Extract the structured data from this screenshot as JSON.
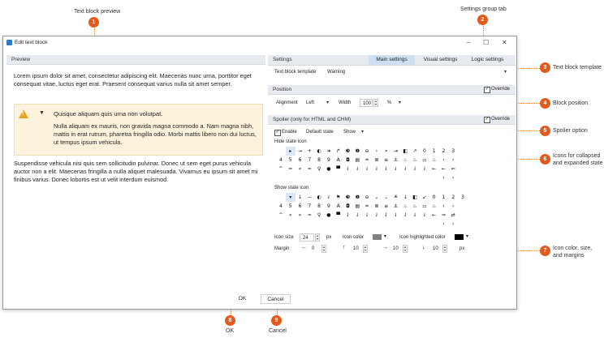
{
  "callouts": [
    {
      "n": "1",
      "label": "Text block preview"
    },
    {
      "n": "2",
      "label": "Settings group tab"
    },
    {
      "n": "3",
      "label": "Text block template"
    },
    {
      "n": "4",
      "label": "Block position"
    },
    {
      "n": "5",
      "label": "Spoiler option"
    },
    {
      "n": "6",
      "label": "Icons for collapsed\nand expanded state"
    },
    {
      "n": "7",
      "label": "Icon color, size,\nand margins"
    },
    {
      "n": "8",
      "label": "OK"
    },
    {
      "n": "9",
      "label": "Cancel"
    }
  ],
  "window": {
    "title": "Edit text block",
    "minimize": "–",
    "maximize": "☐",
    "close": "✕"
  },
  "preview": {
    "header": "Preview",
    "para1": "Lorem ipsum dolor sit amet, consectetur adipiscing elit. Maecenas nunc urna, porttitor eget consequat vitae, luctus eget erat. Praesent consequat varius nulla sit amet semper.",
    "warn_title": "Quisque aliquam quis urna non volutpat.",
    "warn_body": "Nulla aliquam ex mauris, non gravida magna commodo a. Nam magna nibh, mattis in erat rutrum, pharetra fringilla odio. Morbi mattis libero non dui luctus, ut tempus ipsum vehicula.",
    "para2": "Suspendisse vehicula nisi quis sem sollicitudin pulvinar. Donec ut sem eget purus vehicula auctor non a elit. Maecenas fringilla a nulla aliquet malesuada. Vivamus eu ipsum sit amet mi finibus varius. Donec lobortis est ut velit interdum euismod."
  },
  "settings": {
    "header": "Settings",
    "tabs": [
      "Main settings",
      "Visual settings",
      "Logic settings"
    ],
    "template_label": "Text block template",
    "template_value": "Warning",
    "position_header": "Position",
    "override_label": "Override",
    "alignment_label": "Alignment",
    "alignment_value": "Left",
    "width_label": "Width",
    "width_value": "100",
    "width_unit": "%",
    "spoiler_header": "Spoiler (only for HTML and CHM)",
    "enable_label": "Enable",
    "default_state_label": "Default state",
    "default_state_value": "Show",
    "hide_icon_label": "Hide state icon",
    "show_icon_label": "Show state icon",
    "icon_size_label": "Icon size",
    "icon_size_value": "24",
    "icon_size_unit": "px",
    "icon_color_label": "Icon color",
    "icon_color": "#808080",
    "icon_hl_label": "Icon highlighted color",
    "icon_hl_color": "#000000",
    "margin_label": "Margin",
    "margin_left": "0",
    "margin_top": "10",
    "margin_right": "10",
    "margin_bottom": "10",
    "margin_unit": "px"
  },
  "hide_icons": [
    [
      "·",
      "▸",
      "→",
      "+",
      "◐",
      "➜",
      "↱",
      "❸",
      "❶",
      "⊖",
      "›",
      "»",
      "⇥",
      "◧",
      "↗",
      "0",
      "1",
      "2",
      "3"
    ],
    [
      "4",
      "5",
      "6",
      "7",
      "8",
      "9",
      "A",
      "◘",
      "▤",
      "≐",
      "≣",
      "≡",
      "⚓",
      "♨",
      "♨",
      "⚏",
      "♨",
      "‹",
      "›"
    ],
    [
      "^",
      "≈",
      "«",
      "≈",
      "♀",
      "●",
      "▀",
      "⇃",
      "⇃",
      "⇃",
      "⇃",
      "⇃",
      "⇃",
      "⇃",
      "⇃",
      "⇃",
      "←",
      "←",
      "⇐"
    ],
    [
      "",
      "",
      "",
      "",
      "",
      "",
      "",
      "",
      "",
      "",
      "",
      "",
      "",
      "",
      "",
      "",
      "",
      "‹",
      "›"
    ]
  ],
  "show_icons": [
    [
      "·",
      "▾",
      "↓",
      "−",
      "◐",
      "⇃",
      "⚑",
      "❸",
      "❶",
      "⊖",
      "⌄",
      "⌄",
      "≚",
      "↓",
      "◧",
      "↙",
      "0",
      "1",
      "2",
      "3"
    ],
    [
      "4",
      "5",
      "6",
      "7",
      "8",
      "9",
      "A",
      "◘",
      "▤",
      "≐",
      "≣",
      "≡",
      "⚓",
      "♨",
      "♨",
      "⚏",
      "♨",
      "‹",
      "›"
    ],
    [
      "^",
      "«",
      "»",
      "≈",
      "♀",
      "●",
      "▀",
      "⇃",
      "⇃",
      "⇃",
      "⇃",
      "⇃",
      "⇃",
      "⇃",
      "⇃",
      "⇃",
      "←",
      "⇒",
      "⇄"
    ],
    [
      "",
      "",
      "",
      "",
      "",
      "",
      "",
      "",
      "",
      "",
      "",
      "",
      "",
      "",
      "",
      "",
      "",
      "‹",
      "›"
    ]
  ],
  "buttons": {
    "ok": "OK",
    "cancel": "Cancel"
  },
  "accent": "#e35a1d",
  "tab_active_bg": "#cfe0f3"
}
